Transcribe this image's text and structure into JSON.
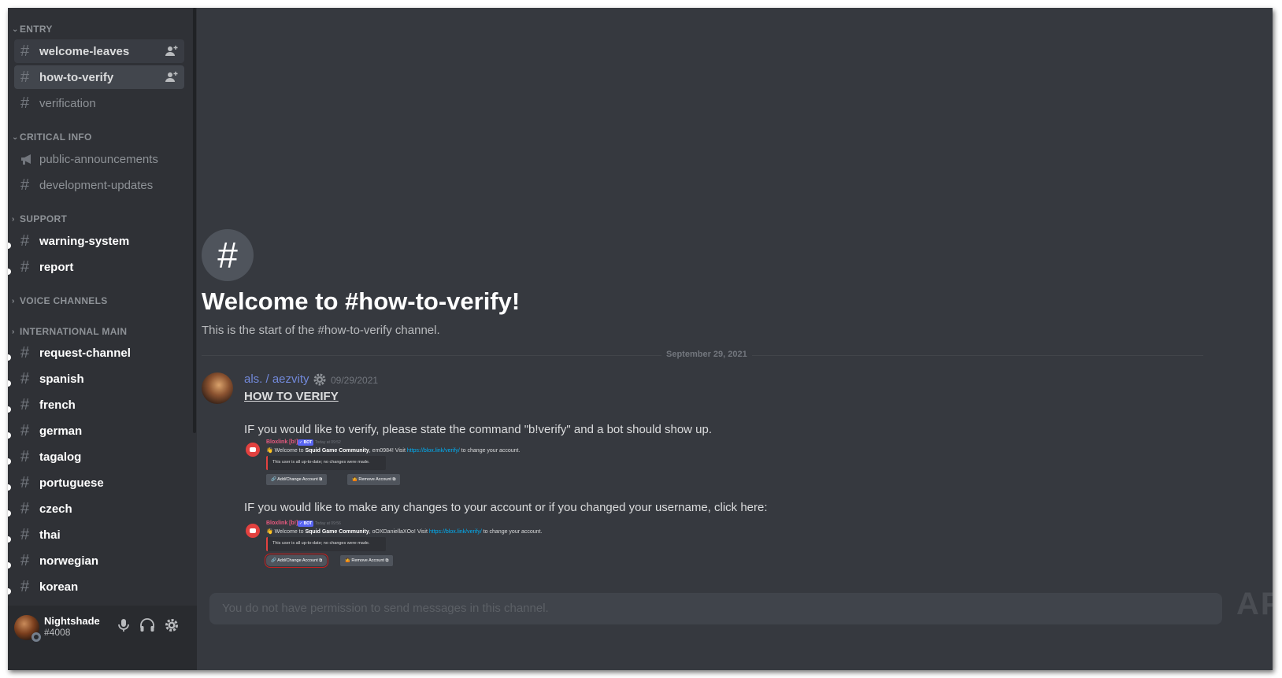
{
  "sidebar": {
    "categories": [
      {
        "label": "ENTRY",
        "expanded": true
      },
      {
        "label": "CRITICAL INFO",
        "expanded": true
      },
      {
        "label": "SUPPORT",
        "expanded": false
      },
      {
        "label": "VOICE CHANNELS",
        "expanded": false
      },
      {
        "label": "INTERNATIONAL MAIN",
        "expanded": false
      }
    ],
    "channels": {
      "welcome_leaves": "welcome-leaves",
      "how_to_verify": "how-to-verify",
      "verification": "verification",
      "public_announcements": "public-announcements",
      "development_updates": "development-updates",
      "warning_system": "warning-system",
      "report": "report",
      "request_channel": "request-channel",
      "spanish": "spanish",
      "french": "french",
      "german": "german",
      "tagalog": "tagalog",
      "portuguese": "portuguese",
      "czech": "czech",
      "thai": "thai",
      "norwegian": "norwegian",
      "korean": "korean"
    },
    "hash_glyph": "#"
  },
  "user_panel": {
    "username": "Nightshade",
    "discriminator": "#4008",
    "icons": [
      "microphone-icon",
      "headphones-icon",
      "settings-gear-icon"
    ]
  },
  "main": {
    "channel_icon": "#",
    "welcome_title": "Welcome to #how-to-verify!",
    "welcome_subtitle": "This is the start of the #how-to-verify channel.",
    "date_divider": "September 29, 2021",
    "message": {
      "author": "als. / aezvity",
      "timestamp": "09/29/2021",
      "heading": "HOW TO VERIFY",
      "line1": "IF you would like to verify, please state the command \"b!verify\" and a bot should show up.",
      "line2": "IF you would like to make any changes to your account or if you changed your username, click here:"
    },
    "bot_shot_1": {
      "bot_name": "Bloxlink [b!]",
      "bot_tag": "✓ BOT",
      "time": "Today at 09:52",
      "welcome_prefix": "👋 Welcome to ",
      "server": "Squid Game Community",
      "mid": ", em0984! Visit ",
      "link": "https://blox.link/verify/",
      "suffix": " to change your account.",
      "embed": "This user is all up-to-date; no changes were made.",
      "btn_add": "🔗 Add/Change Account ⧉",
      "btn_remove": "🤷 Remove Account ⧉"
    },
    "bot_shot_2": {
      "bot_name": "Bloxlink [b!]",
      "bot_tag": "✓ BOT",
      "time": "Today at 09:56",
      "welcome_prefix": "👋 Welcome to ",
      "server": "Squid Game Community",
      "mid": ", oOXDaniellaXOo! Visit ",
      "link": "https://blox.link/verify/",
      "suffix": " to change your account.",
      "embed": "This user is all up-to-date; no changes were made.",
      "btn_add": "🔗 Add/Change Account ⧉",
      "btn_remove": "🤷 Remove Account ⧉"
    },
    "composer_placeholder": "You do not have permission to send messages in this channel."
  },
  "watermark": "APPUALS",
  "colors": {
    "sidebar_bg": "#2f3136",
    "main_bg": "#36393f",
    "author_color": "#7289da",
    "composer_bg": "#40444b"
  }
}
